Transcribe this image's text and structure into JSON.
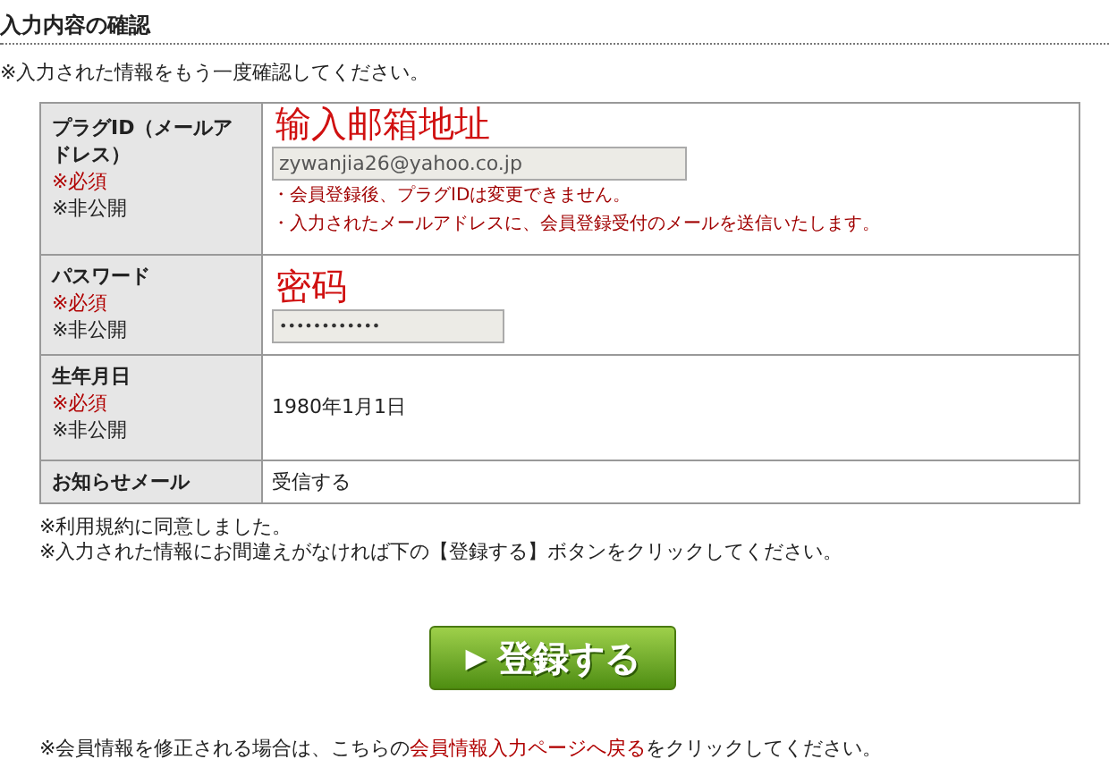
{
  "heading": "入力内容の確認",
  "intro": "※入力された情報をもう一度確認してください。",
  "rows": [
    {
      "label": "プラグID（メールアドレス）",
      "required": "※必須",
      "private": "※非公開",
      "kind": "input",
      "value": "zywanjia26@yahoo.co.jp",
      "annotation": "输入邮箱地址",
      "notes": [
        "・会員登録後、プラグIDは変更できません。",
        "・入力されたメールアドレスに、会員登録受付のメールを送信いたします。"
      ]
    },
    {
      "label": "パスワード",
      "required": "※必須",
      "private": "※非公開",
      "kind": "password",
      "value": "••••••••••••",
      "annotation": "密码"
    },
    {
      "label": "生年月日",
      "required": "※必須",
      "private": "※非公開",
      "kind": "text",
      "value": "1980年1月1日"
    },
    {
      "label": "お知らせメール",
      "kind": "text",
      "value": "受信する"
    }
  ],
  "notes": [
    "※利用規約に同意しました。",
    "※入力された情報にお間違えがなければ下の【登録する】ボタンをクリックしてください。"
  ],
  "submit": {
    "icon": "▶",
    "label": "登録する"
  },
  "footer": {
    "before": "※会員情報を修正される場合は、こちらの",
    "link": "会員情報入力ページへ戻る",
    "after": "をクリックしてください。"
  }
}
